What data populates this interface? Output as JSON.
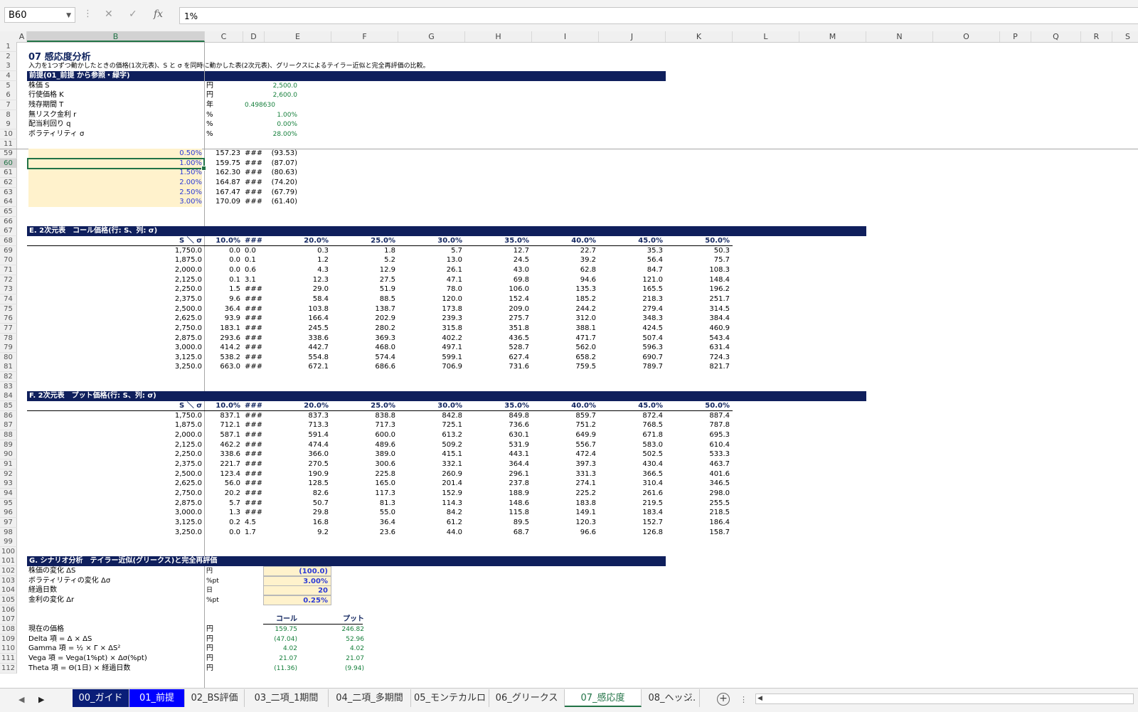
{
  "namebox": "B60",
  "formula": "1%",
  "formula_icons": [
    "close-icon",
    "check-icon",
    "fx-icon"
  ],
  "columns": [
    "A",
    "B",
    "C",
    "D",
    "E",
    "F",
    "G",
    "H",
    "I",
    "J",
    "K",
    "L",
    "M",
    "N",
    "O",
    "P",
    "Q",
    "R",
    "S"
  ],
  "section_header": {
    "title": "07 感応度分析",
    "description": "入力を1つずつ動かしたときの価格(1次元表)、S と σ を同時に動かした表(2次元表)、グリークスによるテイラー近似と完全再評価の比較。",
    "premise_band": "前提(01_前提 から参照・緑字)"
  },
  "premises": [
    {
      "label": "株価 S",
      "unit": "円",
      "value": "2,500.0"
    },
    {
      "label": "行使価格 K",
      "unit": "円",
      "value": "2,600.0"
    },
    {
      "label": "残存期間 T",
      "unit": "年",
      "value": "0.498630"
    },
    {
      "label": "無リスク金利 r",
      "unit": "%",
      "value": "1.00%"
    },
    {
      "label": "配当利回り q",
      "unit": "%",
      "value": "0.00%"
    },
    {
      "label": "ボラティリティ σ",
      "unit": "%",
      "value": "28.00%"
    }
  ],
  "rate_table": [
    {
      "r": "59",
      "b": "0.50%",
      "c": "157.23",
      "d": "###",
      "e": "(93.53)"
    },
    {
      "r": "60",
      "b": "1.00%",
      "c": "159.75",
      "d": "###",
      "e": "(87.07)"
    },
    {
      "r": "61",
      "b": "1.50%",
      "c": "162.30",
      "d": "###",
      "e": "(80.63)"
    },
    {
      "r": "62",
      "b": "2.00%",
      "c": "164.87",
      "d": "###",
      "e": "(74.20)"
    },
    {
      "r": "63",
      "b": "2.50%",
      "c": "167.47",
      "d": "###",
      "e": "(67.79)"
    },
    {
      "r": "64",
      "b": "3.00%",
      "c": "170.09",
      "d": "###",
      "e": "(61.40)"
    }
  ],
  "table_e": {
    "band": "E. 2次元表　コール価格(行: S、列: σ)",
    "corner": "S ＼ σ",
    "headers": [
      "10.0%",
      "###",
      "20.0%",
      "25.0%",
      "30.0%",
      "35.0%",
      "40.0%",
      "45.0%",
      "50.0%"
    ],
    "rows": [
      {
        "s": "1,750.0",
        "v": [
          "0.0",
          "0.0",
          "0.3",
          "1.8",
          "5.7",
          "12.7",
          "22.7",
          "35.3",
          "50.3"
        ]
      },
      {
        "s": "1,875.0",
        "v": [
          "0.0",
          "0.1",
          "1.2",
          "5.2",
          "13.0",
          "24.5",
          "39.2",
          "56.4",
          "75.7"
        ]
      },
      {
        "s": "2,000.0",
        "v": [
          "0.0",
          "0.6",
          "4.3",
          "12.9",
          "26.1",
          "43.0",
          "62.8",
          "84.7",
          "108.3"
        ]
      },
      {
        "s": "2,125.0",
        "v": [
          "0.1",
          "3.1",
          "12.3",
          "27.5",
          "47.1",
          "69.8",
          "94.6",
          "121.0",
          "148.4"
        ]
      },
      {
        "s": "2,250.0",
        "v": [
          "1.5",
          "###",
          "29.0",
          "51.9",
          "78.0",
          "106.0",
          "135.3",
          "165.5",
          "196.2"
        ]
      },
      {
        "s": "2,375.0",
        "v": [
          "9.6",
          "###",
          "58.4",
          "88.5",
          "120.0",
          "152.4",
          "185.2",
          "218.3",
          "251.7"
        ]
      },
      {
        "s": "2,500.0",
        "v": [
          "36.4",
          "###",
          "103.8",
          "138.7",
          "173.8",
          "209.0",
          "244.2",
          "279.4",
          "314.5"
        ]
      },
      {
        "s": "2,625.0",
        "v": [
          "93.9",
          "###",
          "166.4",
          "202.9",
          "239.3",
          "275.7",
          "312.0",
          "348.3",
          "384.4"
        ]
      },
      {
        "s": "2,750.0",
        "v": [
          "183.1",
          "###",
          "245.5",
          "280.2",
          "315.8",
          "351.8",
          "388.1",
          "424.5",
          "460.9"
        ]
      },
      {
        "s": "2,875.0",
        "v": [
          "293.6",
          "###",
          "338.6",
          "369.3",
          "402.2",
          "436.5",
          "471.7",
          "507.4",
          "543.4"
        ]
      },
      {
        "s": "3,000.0",
        "v": [
          "414.2",
          "###",
          "442.7",
          "468.0",
          "497.1",
          "528.7",
          "562.0",
          "596.3",
          "631.4"
        ]
      },
      {
        "s": "3,125.0",
        "v": [
          "538.2",
          "###",
          "554.8",
          "574.4",
          "599.1",
          "627.4",
          "658.2",
          "690.7",
          "724.3"
        ]
      },
      {
        "s": "3,250.0",
        "v": [
          "663.0",
          "###",
          "672.1",
          "686.6",
          "706.9",
          "731.6",
          "759.5",
          "789.7",
          "821.7"
        ]
      }
    ]
  },
  "table_f": {
    "band": "F. 2次元表　プット価格(行: S、列: σ)",
    "corner": "S ＼ σ",
    "headers": [
      "10.0%",
      "###",
      "20.0%",
      "25.0%",
      "30.0%",
      "35.0%",
      "40.0%",
      "45.0%",
      "50.0%"
    ],
    "rows": [
      {
        "s": "1,750.0",
        "v": [
          "837.1",
          "###",
          "837.3",
          "838.8",
          "842.8",
          "849.8",
          "859.7",
          "872.4",
          "887.4"
        ]
      },
      {
        "s": "1,875.0",
        "v": [
          "712.1",
          "###",
          "713.3",
          "717.3",
          "725.1",
          "736.6",
          "751.2",
          "768.5",
          "787.8"
        ]
      },
      {
        "s": "2,000.0",
        "v": [
          "587.1",
          "###",
          "591.4",
          "600.0",
          "613.2",
          "630.1",
          "649.9",
          "671.8",
          "695.3"
        ]
      },
      {
        "s": "2,125.0",
        "v": [
          "462.2",
          "###",
          "474.4",
          "489.6",
          "509.2",
          "531.9",
          "556.7",
          "583.0",
          "610.4"
        ]
      },
      {
        "s": "2,250.0",
        "v": [
          "338.6",
          "###",
          "366.0",
          "389.0",
          "415.1",
          "443.1",
          "472.4",
          "502.5",
          "533.3"
        ]
      },
      {
        "s": "2,375.0",
        "v": [
          "221.7",
          "###",
          "270.5",
          "300.6",
          "332.1",
          "364.4",
          "397.3",
          "430.4",
          "463.7"
        ]
      },
      {
        "s": "2,500.0",
        "v": [
          "123.4",
          "###",
          "190.9",
          "225.8",
          "260.9",
          "296.1",
          "331.3",
          "366.5",
          "401.6"
        ]
      },
      {
        "s": "2,625.0",
        "v": [
          "56.0",
          "###",
          "128.5",
          "165.0",
          "201.4",
          "237.8",
          "274.1",
          "310.4",
          "346.5"
        ]
      },
      {
        "s": "2,750.0",
        "v": [
          "20.2",
          "###",
          "82.6",
          "117.3",
          "152.9",
          "188.9",
          "225.2",
          "261.6",
          "298.0"
        ]
      },
      {
        "s": "2,875.0",
        "v": [
          "5.7",
          "###",
          "50.7",
          "81.3",
          "114.3",
          "148.6",
          "183.8",
          "219.5",
          "255.5"
        ]
      },
      {
        "s": "3,000.0",
        "v": [
          "1.3",
          "###",
          "29.8",
          "55.0",
          "84.2",
          "115.8",
          "149.1",
          "183.4",
          "218.5"
        ]
      },
      {
        "s": "3,125.0",
        "v": [
          "0.2",
          "4.5",
          "16.8",
          "36.4",
          "61.2",
          "89.5",
          "120.3",
          "152.7",
          "186.4"
        ]
      },
      {
        "s": "3,250.0",
        "v": [
          "0.0",
          "1.7",
          "9.2",
          "23.6",
          "44.0",
          "68.7",
          "96.6",
          "126.8",
          "158.7"
        ]
      }
    ]
  },
  "table_g": {
    "band": "G. シナリオ分析　テイラー近似(グリークス)と完全再評価",
    "inputs": [
      {
        "label": "株価の変化 ΔS",
        "unit": "円",
        "value": "(100.0)"
      },
      {
        "label": "ボラティリティの変化 Δσ",
        "unit": "%pt",
        "value": "3.00%"
      },
      {
        "label": "経過日数",
        "unit": "日",
        "value": "20"
      },
      {
        "label": "金利の変化 Δr",
        "unit": "%pt",
        "value": "0.25%"
      }
    ],
    "col_call": "コール",
    "col_put": "プット",
    "results": [
      {
        "label": "現在の価格",
        "unit": "円",
        "call": "159.75",
        "put": "246.82"
      },
      {
        "label": "Delta 項 = Δ × ΔS",
        "unit": "円",
        "call": "(47.04)",
        "put": "52.96"
      },
      {
        "label": "Gamma 項 = ½ × Γ × ΔS²",
        "unit": "円",
        "call": "4.02",
        "put": "4.02"
      },
      {
        "label": "Vega 項 = Vega(1%pt) × Δσ(%pt)",
        "unit": "円",
        "call": "21.07",
        "put": "21.07"
      },
      {
        "label": "Theta 項 = Θ(1日) × 経過日数",
        "unit": "円",
        "call": "(11.36)",
        "put": "(9.94)"
      }
    ]
  },
  "sheet_tabs": [
    "00_ガイド",
    "01_前提",
    "02_BS評価",
    "03_二項_1期間",
    "04_二項_多期間",
    "05_モンテカルロ",
    "06_グリークス",
    "07_感応度",
    "08_ヘッジ"
  ],
  "tab_more": "..."
}
